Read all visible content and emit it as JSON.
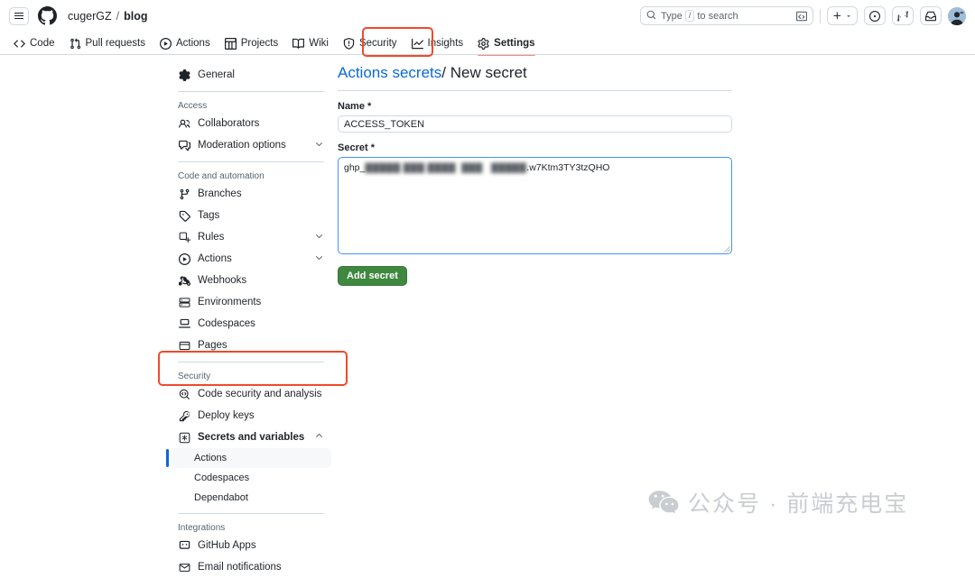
{
  "header": {
    "menu_label": "menu",
    "owner": "cugerGZ",
    "separator": "/",
    "repo": "blog",
    "search": {
      "placeholder_prefix": "Type",
      "kbd": "/",
      "placeholder_suffix": "to search"
    },
    "create_label": "+",
    "icons": [
      "search-icon",
      "terminal-icon",
      "plus-icon",
      "chevron-down-icon",
      "issues-icon",
      "pull-request-icon",
      "inbox-icon",
      "avatar"
    ]
  },
  "repo_nav": {
    "tabs": [
      {
        "label": "Code",
        "icon": "code-icon",
        "active": false
      },
      {
        "label": "Pull requests",
        "icon": "git-pull-request-icon",
        "active": false
      },
      {
        "label": "Actions",
        "icon": "play-circle-icon",
        "active": false
      },
      {
        "label": "Projects",
        "icon": "table-icon",
        "active": false
      },
      {
        "label": "Wiki",
        "icon": "book-icon",
        "active": false
      },
      {
        "label": "Security",
        "icon": "shield-icon",
        "active": false
      },
      {
        "label": "Insights",
        "icon": "graph-icon",
        "active": false
      },
      {
        "label": "Settings",
        "icon": "gear-icon",
        "active": true
      }
    ]
  },
  "sidebar": {
    "groups": [
      {
        "title": null,
        "items": [
          {
            "label": "General",
            "icon": "gear-icon",
            "chevron": false,
            "bold": false
          }
        ]
      },
      {
        "title": "Access",
        "items": [
          {
            "label": "Collaborators",
            "icon": "people-icon",
            "chevron": false,
            "bold": false
          },
          {
            "label": "Moderation options",
            "icon": "comment-discussion-icon",
            "chevron": true,
            "bold": false
          }
        ]
      },
      {
        "title": "Code and automation",
        "items": [
          {
            "label": "Branches",
            "icon": "git-branch-icon",
            "chevron": false,
            "bold": false
          },
          {
            "label": "Tags",
            "icon": "tag-icon",
            "chevron": false,
            "bold": false
          },
          {
            "label": "Rules",
            "icon": "rules-icon",
            "chevron": true,
            "bold": false
          },
          {
            "label": "Actions",
            "icon": "play-circle-icon",
            "chevron": true,
            "bold": false
          },
          {
            "label": "Webhooks",
            "icon": "webhook-icon",
            "chevron": false,
            "bold": false
          },
          {
            "label": "Environments",
            "icon": "server-icon",
            "chevron": false,
            "bold": false
          },
          {
            "label": "Codespaces",
            "icon": "codespaces-icon",
            "chevron": false,
            "bold": false
          },
          {
            "label": "Pages",
            "icon": "browser-icon",
            "chevron": false,
            "bold": false
          }
        ]
      },
      {
        "title": "Security",
        "items": [
          {
            "label": "Code security and analysis",
            "icon": "code-scan-icon",
            "chevron": false,
            "bold": false
          },
          {
            "label": "Deploy keys",
            "icon": "key-icon",
            "chevron": false,
            "bold": false
          },
          {
            "label": "Secrets and variables",
            "icon": "key-asterisk-icon",
            "chevron": true,
            "expanded": true,
            "bold": true,
            "subitems": [
              {
                "label": "Actions",
                "selected": true
              },
              {
                "label": "Codespaces",
                "selected": false
              },
              {
                "label": "Dependabot",
                "selected": false
              }
            ]
          }
        ]
      },
      {
        "title": "Integrations",
        "items": [
          {
            "label": "GitHub Apps",
            "icon": "github-apps-icon",
            "chevron": false,
            "bold": false
          },
          {
            "label": "Email notifications",
            "icon": "mail-icon",
            "chevron": false,
            "bold": false
          }
        ]
      }
    ]
  },
  "main": {
    "breadcrumb_link": "Actions secrets",
    "breadcrumb_sep": "/",
    "breadcrumb_current": "New secret",
    "name_label": "Name *",
    "name_value": "ACCESS_TOKEN",
    "secret_label": "Secret *",
    "secret_value_visible_prefix": "ghp_",
    "secret_value_redacted": "▓▓▓▓▓ ▓▓▓ ▓▓▓▓  ▓▓▓   ▓▓▓▓▓",
    "secret_value_visible_suffix": ".w7Ktm3TY3tzQHO",
    "submit_label": "Add secret"
  },
  "watermark": {
    "text": "公众号 · 前端充电宝",
    "icon": "wechat-icon"
  },
  "colors": {
    "accent_blue": "#0969da",
    "annotation_red": "#f04a2a",
    "active_tab_orange": "#fd8c73",
    "button_green": "#3f883f",
    "border_gray": "#d1d9e0",
    "muted_text": "#59636e",
    "focus_blue": "#4493f8"
  }
}
